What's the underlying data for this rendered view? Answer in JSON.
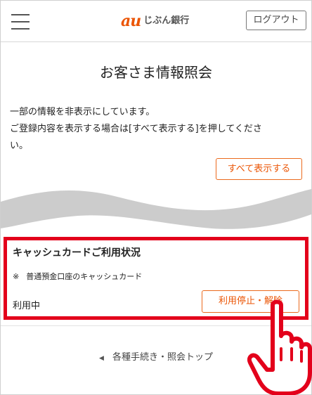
{
  "header": {
    "logo_au": "au",
    "logo_text": "じぶん銀行",
    "logout_label": "ログアウト"
  },
  "page": {
    "title": "お客さま情報照会",
    "notice_line1": "一部の情報を非表示にしています。",
    "notice_line2": "ご登録内容を表示する場合は[すべて表示する]を押してくださ",
    "notice_line3": "い。",
    "show_all_label": "すべて表示する"
  },
  "card": {
    "title": "キャッシュカードご利用状況",
    "note_mark": "※",
    "note": "普通預金口座のキャッシュカード",
    "status": "利用中",
    "stop_label": "利用停止・解除"
  },
  "footer": {
    "back_label": "各種手続き・照会トップ"
  },
  "colors": {
    "accent": "#eb5505",
    "highlight": "#e3001b"
  }
}
